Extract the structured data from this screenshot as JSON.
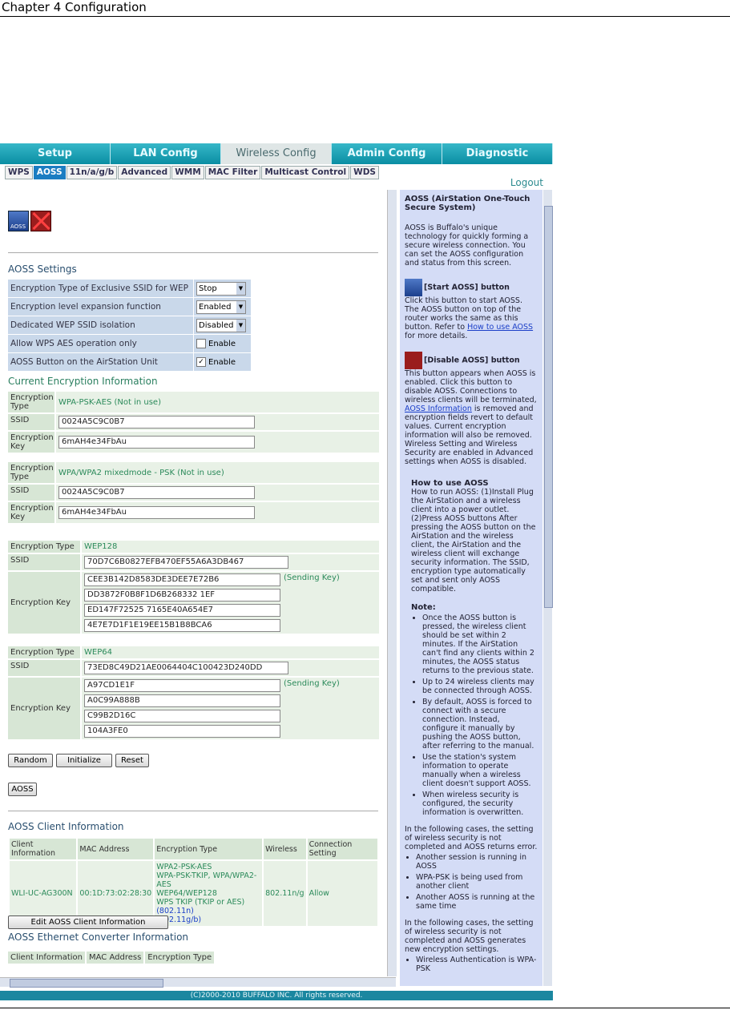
{
  "document": {
    "chapter_header": "Chapter 4  Configuration"
  },
  "tabs": [
    "Setup",
    "LAN Config",
    "Wireless Config",
    "Admin Config",
    "Diagnostic"
  ],
  "active_tab": "Wireless Config",
  "subtabs": [
    "WPS",
    "AOSS",
    "11n/a/g/b",
    "Advanced",
    "WMM",
    "MAC Filter",
    "Multicast Control",
    "WDS"
  ],
  "active_subtab": "AOSS",
  "logout": "Logout",
  "aoss_settings": {
    "title": "AOSS Settings",
    "rows": [
      {
        "label": "Encryption Type of Exclusive SSID for WEP",
        "value": "Stop"
      },
      {
        "label": "Encryption level expansion function",
        "value": "Enabled"
      },
      {
        "label": "Dedicated WEP SSID isolation",
        "value": "Disabled"
      },
      {
        "label": "Allow WPS AES operation only",
        "value": "Enable"
      },
      {
        "label": "AOSS Button on the AirStation Unit",
        "value": "Enable"
      }
    ]
  },
  "current_encryption": {
    "title": "Current Encryption Information",
    "blocks": [
      {
        "type_label": "Encryption Type",
        "type_value": "WPA-PSK-AES (Not in use)",
        "ssid_label": "SSID",
        "ssid": "0024A5C9C0B7",
        "key_label": "Encryption Key",
        "key": "6mAH4e34FbAu"
      },
      {
        "type_label": "Encryption Type",
        "type_value": "WPA/WPA2 mixedmode - PSK (Not in use)",
        "ssid_label": "SSID",
        "ssid": "0024A5C9C0B7",
        "key_label": "Encryption Key",
        "key": "6mAH4e34FbAu"
      },
      {
        "type_label": "Encryption Type",
        "type_value": "WEP128",
        "ssid_label": "SSID",
        "ssid": "70D7C6B0827EFB470EF55A6A3DB467",
        "key_label": "Encryption Key",
        "keys": [
          "CEE3B142D8583DE3DEE7E72B6",
          "DD3872F0B8F1D6B268332 1EF",
          "ED147F72525 7165E40A654E7",
          "4E7E7D1F1E19EE15B1B8BCA6"
        ],
        "key_link": "(Sending Key)"
      },
      {
        "type_label": "Encryption Type",
        "type_value": "WEP64",
        "ssid_label": "SSID",
        "ssid": "73ED8C49D21AE0064404C100423D240DD",
        "key_label": "Encryption Key",
        "keys": [
          "A97CD1E1F",
          "A0C99A888B",
          "C99B2D16C",
          "104A3FE0"
        ],
        "key_link": "(Sending Key)"
      }
    ]
  },
  "buttons": {
    "random": "Random",
    "initialize": "Initialize",
    "reset": "Reset",
    "aoss": "AOSS"
  },
  "client_info": {
    "title": "AOSS Client Information",
    "headers": [
      "Client Information",
      "MAC Address",
      "Encryption Type",
      "Wireless",
      "Connection Setting"
    ],
    "row": {
      "client": "WLI-UC-AG300N",
      "mac": "00:1D:73:02:28:30",
      "enc": [
        "WPA2-PSK-AES",
        "WPA-PSK-TKIP, WPA/WPA2-AES",
        "WEP64/WEP128",
        "WPS TKIP (TKIP or AES)"
      ],
      "enc_side": [
        "(802.11n)",
        "(802.11g/b)"
      ],
      "wireless": "802.11n/g",
      "setting": "Allow"
    },
    "edit_button": "Edit AOSS Client Information"
  },
  "ethernet_converter": {
    "title": "AOSS Ethernet Converter Information",
    "headers": [
      "Client Information",
      "MAC Address",
      "Encryption Type"
    ]
  },
  "help": {
    "title": "AOSS (AirStation One-Touch Secure System)",
    "intro": "AOSS is Buffalo's unique technology for quickly forming a secure wireless connection. You can set the AOSS configuration and status from this screen.",
    "start_title": "[Start AOSS] button",
    "start_text": "Click this button to start AOSS. The AOSS button on top of the router works the same as this button. Refer to",
    "start_link": "How to use AOSS",
    "start_text2": "for more details.",
    "disable_title": "[Disable AOSS] button",
    "disable_text": "This button appears when AOSS is enabled. Click this button to disable AOSS. Connections to wireless clients will be terminated,",
    "disable_link": "AOSS Information",
    "disable_text2": "is removed and encryption fields revert to default values. Current encryption information will also be removed. Wireless Setting and Wireless Security are enabled in Advanced settings when AOSS is disabled.",
    "how_title": "How to use AOSS",
    "how_text": "How to run AOSS: (1)Install Plug the AirStation and a wireless client into a power outlet. (2)Press AOSS buttons After pressing the AOSS button on the AirStation and the wireless client, the AirStation and the wireless client will exchange security information. The SSID, encryption type automatically set and sent only AOSS compatible.",
    "note_title": "Note:",
    "notes": [
      "Once the AOSS button is pressed, the wireless client should be set within 2 minutes. If the AirStation can't find any clients within 2 minutes, the AOSS status returns to the previous state.",
      "Up to 24 wireless clients may be connected through AOSS.",
      "By default, AOSS is forced to connect with a secure connection. Instead, configure it manually by pushing the AOSS button, after referring to the manual.",
      "Use the station's system information to operate manually when a wireless client doesn't support AOSS.",
      "When wireless security is configured, the security information is overwritten."
    ],
    "following1": "In the following cases, the setting of wireless security is not completed and AOSS returns error.",
    "list1": [
      "Another session is running in AOSS",
      "WPA-PSK is being used from another client",
      "Another AOSS is running at the same time"
    ],
    "following2": "In the following cases, the setting of wireless security is not completed and AOSS generates new encryption settings.",
    "list2": [
      "Wireless Authentication is WPA-PSK"
    ]
  },
  "footer": "(C)2000-2010 BUFFALO INC. All rights reserved."
}
